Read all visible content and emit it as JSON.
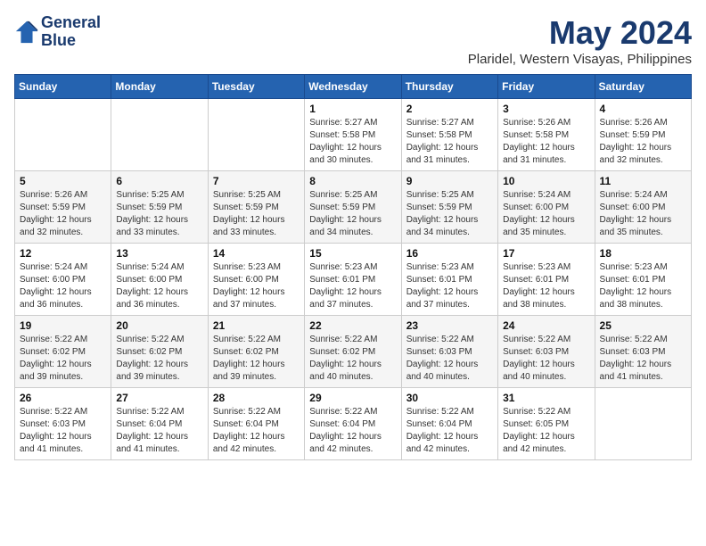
{
  "header": {
    "logo_line1": "General",
    "logo_line2": "Blue",
    "month": "May 2024",
    "location": "Plaridel, Western Visayas, Philippines"
  },
  "weekdays": [
    "Sunday",
    "Monday",
    "Tuesday",
    "Wednesday",
    "Thursday",
    "Friday",
    "Saturday"
  ],
  "weeks": [
    [
      {
        "day": "",
        "info": ""
      },
      {
        "day": "",
        "info": ""
      },
      {
        "day": "",
        "info": ""
      },
      {
        "day": "1",
        "info": "Sunrise: 5:27 AM\nSunset: 5:58 PM\nDaylight: 12 hours\nand 30 minutes."
      },
      {
        "day": "2",
        "info": "Sunrise: 5:27 AM\nSunset: 5:58 PM\nDaylight: 12 hours\nand 31 minutes."
      },
      {
        "day": "3",
        "info": "Sunrise: 5:26 AM\nSunset: 5:58 PM\nDaylight: 12 hours\nand 31 minutes."
      },
      {
        "day": "4",
        "info": "Sunrise: 5:26 AM\nSunset: 5:59 PM\nDaylight: 12 hours\nand 32 minutes."
      }
    ],
    [
      {
        "day": "5",
        "info": "Sunrise: 5:26 AM\nSunset: 5:59 PM\nDaylight: 12 hours\nand 32 minutes."
      },
      {
        "day": "6",
        "info": "Sunrise: 5:25 AM\nSunset: 5:59 PM\nDaylight: 12 hours\nand 33 minutes."
      },
      {
        "day": "7",
        "info": "Sunrise: 5:25 AM\nSunset: 5:59 PM\nDaylight: 12 hours\nand 33 minutes."
      },
      {
        "day": "8",
        "info": "Sunrise: 5:25 AM\nSunset: 5:59 PM\nDaylight: 12 hours\nand 34 minutes."
      },
      {
        "day": "9",
        "info": "Sunrise: 5:25 AM\nSunset: 5:59 PM\nDaylight: 12 hours\nand 34 minutes."
      },
      {
        "day": "10",
        "info": "Sunrise: 5:24 AM\nSunset: 6:00 PM\nDaylight: 12 hours\nand 35 minutes."
      },
      {
        "day": "11",
        "info": "Sunrise: 5:24 AM\nSunset: 6:00 PM\nDaylight: 12 hours\nand 35 minutes."
      }
    ],
    [
      {
        "day": "12",
        "info": "Sunrise: 5:24 AM\nSunset: 6:00 PM\nDaylight: 12 hours\nand 36 minutes."
      },
      {
        "day": "13",
        "info": "Sunrise: 5:24 AM\nSunset: 6:00 PM\nDaylight: 12 hours\nand 36 minutes."
      },
      {
        "day": "14",
        "info": "Sunrise: 5:23 AM\nSunset: 6:00 PM\nDaylight: 12 hours\nand 37 minutes."
      },
      {
        "day": "15",
        "info": "Sunrise: 5:23 AM\nSunset: 6:01 PM\nDaylight: 12 hours\nand 37 minutes."
      },
      {
        "day": "16",
        "info": "Sunrise: 5:23 AM\nSunset: 6:01 PM\nDaylight: 12 hours\nand 37 minutes."
      },
      {
        "day": "17",
        "info": "Sunrise: 5:23 AM\nSunset: 6:01 PM\nDaylight: 12 hours\nand 38 minutes."
      },
      {
        "day": "18",
        "info": "Sunrise: 5:23 AM\nSunset: 6:01 PM\nDaylight: 12 hours\nand 38 minutes."
      }
    ],
    [
      {
        "day": "19",
        "info": "Sunrise: 5:22 AM\nSunset: 6:02 PM\nDaylight: 12 hours\nand 39 minutes."
      },
      {
        "day": "20",
        "info": "Sunrise: 5:22 AM\nSunset: 6:02 PM\nDaylight: 12 hours\nand 39 minutes."
      },
      {
        "day": "21",
        "info": "Sunrise: 5:22 AM\nSunset: 6:02 PM\nDaylight: 12 hours\nand 39 minutes."
      },
      {
        "day": "22",
        "info": "Sunrise: 5:22 AM\nSunset: 6:02 PM\nDaylight: 12 hours\nand 40 minutes."
      },
      {
        "day": "23",
        "info": "Sunrise: 5:22 AM\nSunset: 6:03 PM\nDaylight: 12 hours\nand 40 minutes."
      },
      {
        "day": "24",
        "info": "Sunrise: 5:22 AM\nSunset: 6:03 PM\nDaylight: 12 hours\nand 40 minutes."
      },
      {
        "day": "25",
        "info": "Sunrise: 5:22 AM\nSunset: 6:03 PM\nDaylight: 12 hours\nand 41 minutes."
      }
    ],
    [
      {
        "day": "26",
        "info": "Sunrise: 5:22 AM\nSunset: 6:03 PM\nDaylight: 12 hours\nand 41 minutes."
      },
      {
        "day": "27",
        "info": "Sunrise: 5:22 AM\nSunset: 6:04 PM\nDaylight: 12 hours\nand 41 minutes."
      },
      {
        "day": "28",
        "info": "Sunrise: 5:22 AM\nSunset: 6:04 PM\nDaylight: 12 hours\nand 42 minutes."
      },
      {
        "day": "29",
        "info": "Sunrise: 5:22 AM\nSunset: 6:04 PM\nDaylight: 12 hours\nand 42 minutes."
      },
      {
        "day": "30",
        "info": "Sunrise: 5:22 AM\nSunset: 6:04 PM\nDaylight: 12 hours\nand 42 minutes."
      },
      {
        "day": "31",
        "info": "Sunrise: 5:22 AM\nSunset: 6:05 PM\nDaylight: 12 hours\nand 42 minutes."
      },
      {
        "day": "",
        "info": ""
      }
    ]
  ]
}
